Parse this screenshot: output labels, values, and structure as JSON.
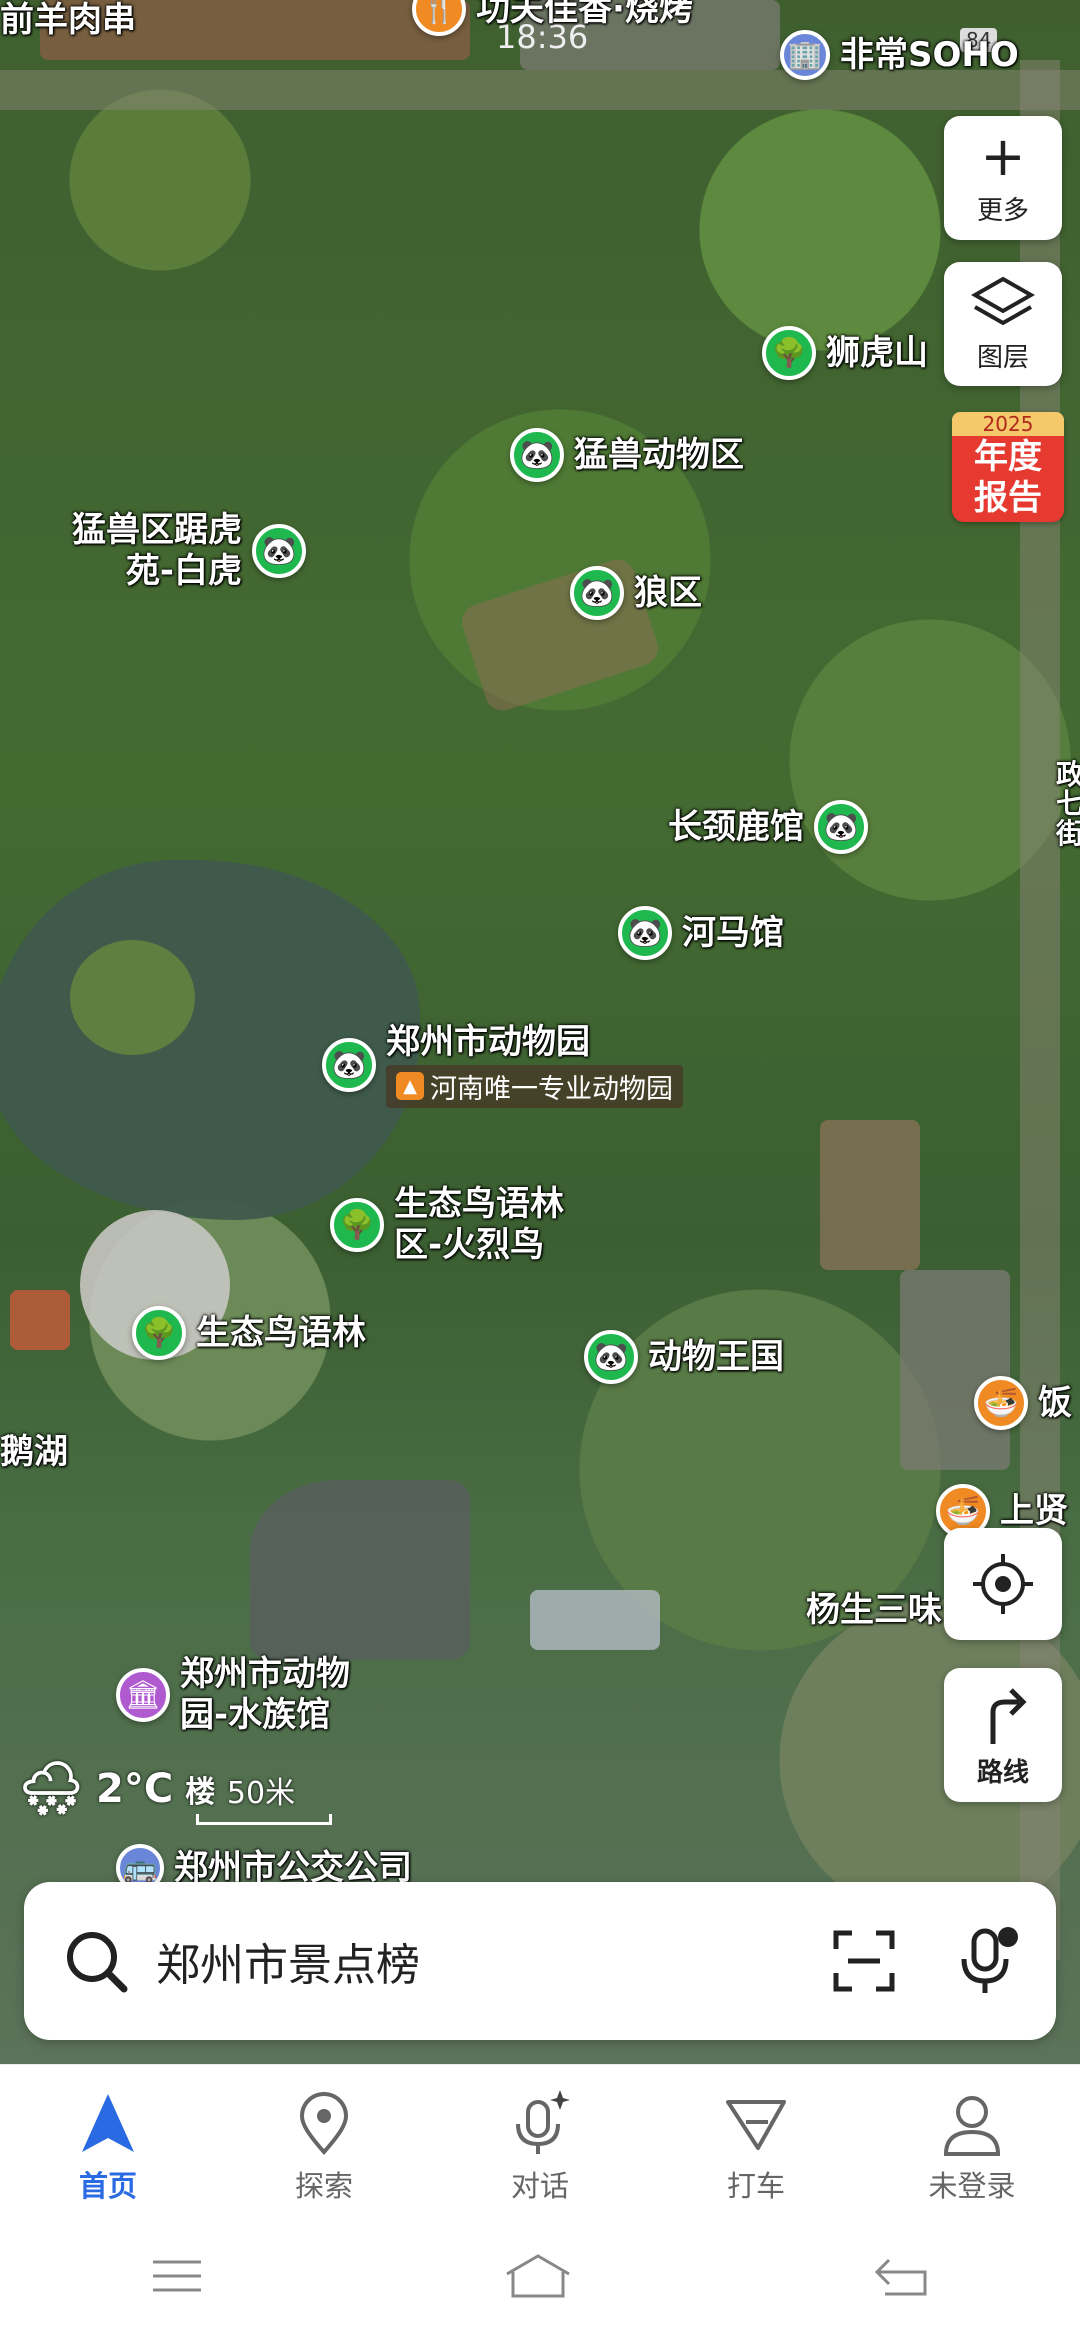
{
  "status_bar": {
    "time": "18:36",
    "battery": "84",
    "carrier_text": "非常SOHO"
  },
  "top_places": {
    "left": "前羊肉串",
    "middle": "功夫佳香·烧烤"
  },
  "side_buttons": {
    "more": "更多",
    "layers": "图层",
    "year_report_line1": "2025",
    "year_report_line2": "年度",
    "year_report_line3": "报告",
    "locate": "",
    "route": "路线"
  },
  "pois": {
    "lion_tiger_hill": "狮虎山",
    "beast_area": "猛兽动物区",
    "tiger_garden": "猛兽区踞虎\n苑-白虎",
    "wolf_area": "狼区",
    "giraffe": "长颈鹿馆",
    "hippo": "河马馆",
    "zoo": "郑州市动物园",
    "zoo_tag": "河南唯一专业动物园",
    "bird_forest_flamingo": "生态鸟语林\n区-火烈鸟",
    "bird_forest": "生态鸟语林",
    "animal_kingdom": "动物王国",
    "swan_lake": "鹅湖",
    "aquarium": "郑州市动物\n园-水族馆",
    "yang_sheng": "杨生三味",
    "right_edge_1": "饭",
    "right_edge_2": "上贤",
    "right_edge_3": "政\n七\n街",
    "bus_company": "郑州市公交公司"
  },
  "weather": {
    "temp": "2°C",
    "floor_hint": "楼"
  },
  "scale": {
    "label": "50米"
  },
  "search": {
    "query": "郑州市景点榜"
  },
  "tabs": [
    {
      "label": "首页",
      "icon": "navigation-arrow-icon",
      "active": true
    },
    {
      "label": "探索",
      "icon": "location-pin-icon",
      "active": false
    },
    {
      "label": "对话",
      "icon": "microphone-sparkle-icon",
      "active": false
    },
    {
      "label": "打车",
      "icon": "taxi-flag-icon",
      "active": false
    },
    {
      "label": "未登录",
      "icon": "user-icon",
      "active": false
    }
  ],
  "colors": {
    "accent": "#2a6be3",
    "poi_green": "#1fb84f",
    "year_red": "#e63a31"
  }
}
